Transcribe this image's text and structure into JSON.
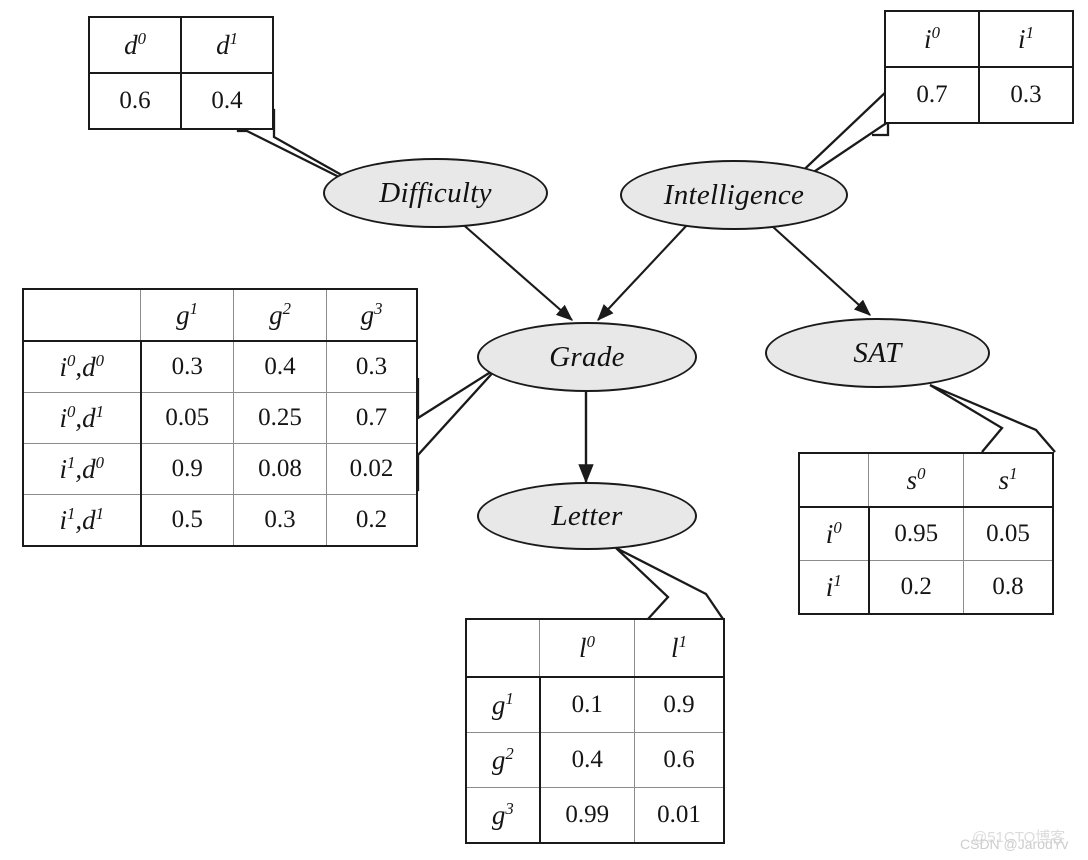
{
  "figure": {
    "title": "Student Bayesian Network with CPDs",
    "node_fill": "#e8e8e8",
    "node_stroke": "#1a1a1a",
    "table_border": "#1a1a1a",
    "background": "#ffffff"
  },
  "nodes": [
    {
      "id": "difficulty",
      "label": "Difficulty"
    },
    {
      "id": "intelligence",
      "label": "Intelligence"
    },
    {
      "id": "grade",
      "label": "Grade"
    },
    {
      "id": "sat",
      "label": "SAT"
    },
    {
      "id": "letter",
      "label": "Letter"
    }
  ],
  "edges": [
    {
      "from": "Difficulty",
      "to": "Grade"
    },
    {
      "from": "Intelligence",
      "to": "Grade"
    },
    {
      "from": "Intelligence",
      "to": "SAT"
    },
    {
      "from": "Grade",
      "to": "Letter"
    }
  ],
  "tables": {
    "difficulty": {
      "for_node": "Difficulty",
      "columns": [
        "d0",
        "d1"
      ],
      "column_base": [
        "d",
        "d"
      ],
      "column_sup": [
        "0",
        "1"
      ],
      "values": [
        "0.6",
        "0.4"
      ]
    },
    "intelligence": {
      "for_node": "Intelligence",
      "columns": [
        "i0",
        "i1"
      ],
      "column_base": [
        "i",
        "i"
      ],
      "column_sup": [
        "0",
        "1"
      ],
      "values": [
        "0.7",
        "0.3"
      ]
    },
    "grade": {
      "for_node": "Grade",
      "corner": "",
      "columns": [
        {
          "base": "g",
          "sup": "1"
        },
        {
          "base": "g",
          "sup": "2"
        },
        {
          "base": "g",
          "sup": "3"
        }
      ],
      "rows": [
        {
          "cond": [
            {
              "base": "i",
              "sup": "0"
            },
            {
              "base": "d",
              "sup": "0"
            }
          ],
          "values": [
            "0.3",
            "0.4",
            "0.3"
          ]
        },
        {
          "cond": [
            {
              "base": "i",
              "sup": "0"
            },
            {
              "base": "d",
              "sup": "1"
            }
          ],
          "values": [
            "0.05",
            "0.25",
            "0.7"
          ]
        },
        {
          "cond": [
            {
              "base": "i",
              "sup": "1"
            },
            {
              "base": "d",
              "sup": "0"
            }
          ],
          "values": [
            "0.9",
            "0.08",
            "0.02"
          ]
        },
        {
          "cond": [
            {
              "base": "i",
              "sup": "1"
            },
            {
              "base": "d",
              "sup": "1"
            }
          ],
          "values": [
            "0.5",
            "0.3",
            "0.2"
          ]
        }
      ]
    },
    "sat": {
      "for_node": "SAT",
      "corner": "",
      "columns": [
        {
          "base": "s",
          "sup": "0"
        },
        {
          "base": "s",
          "sup": "1"
        }
      ],
      "rows": [
        {
          "cond": [
            {
              "base": "i",
              "sup": "0"
            }
          ],
          "values": [
            "0.95",
            "0.05"
          ]
        },
        {
          "cond": [
            {
              "base": "i",
              "sup": "1"
            }
          ],
          "values": [
            "0.2",
            "0.8"
          ]
        }
      ]
    },
    "letter": {
      "for_node": "Letter",
      "corner": "",
      "columns": [
        {
          "base": "l",
          "sup": "0"
        },
        {
          "base": "l",
          "sup": "1"
        }
      ],
      "rows": [
        {
          "cond": [
            {
              "base": "g",
              "sup": "1"
            }
          ],
          "values": [
            "0.1",
            "0.9"
          ]
        },
        {
          "cond": [
            {
              "base": "g",
              "sup": "2"
            }
          ],
          "values": [
            "0.4",
            "0.6"
          ]
        },
        {
          "cond": [
            {
              "base": "g",
              "sup": "3"
            }
          ],
          "values": [
            "0.99",
            "0.01"
          ]
        }
      ]
    }
  },
  "watermarks": {
    "back": "@51CTO博客",
    "front": "CSDN @JarodYv"
  }
}
